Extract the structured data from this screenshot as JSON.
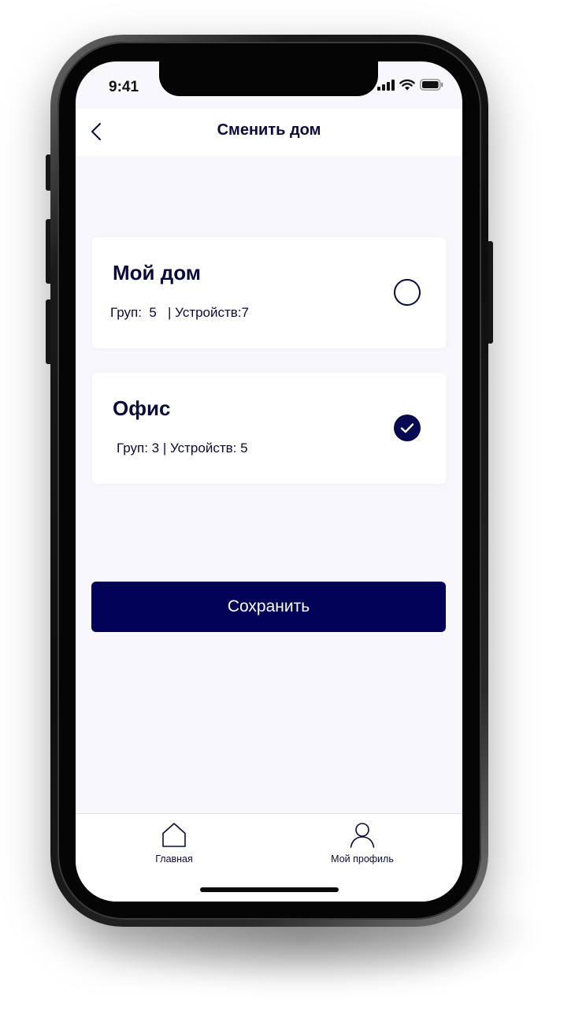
{
  "status_bar": {
    "time": "9:41",
    "signal_icon": "cellular-signal-icon",
    "wifi_icon": "wifi-icon",
    "battery_icon": "battery-icon"
  },
  "header": {
    "title": "Сменить дом",
    "back_icon": "chevron-left-icon"
  },
  "homes": [
    {
      "name": "Мой дом",
      "meta": "Груп:  5   | Устройств:7",
      "selected": false
    },
    {
      "name": "Офис",
      "meta": "Груп: 3 | Устройств: 5",
      "selected": true
    }
  ],
  "save_label": "Сохранить",
  "tabbar": {
    "home_label": "Главная",
    "profile_label": "Мой профиль"
  },
  "colors": {
    "primary": "#020256",
    "text": "#0a0a3c",
    "background": "#f7f7fc"
  }
}
